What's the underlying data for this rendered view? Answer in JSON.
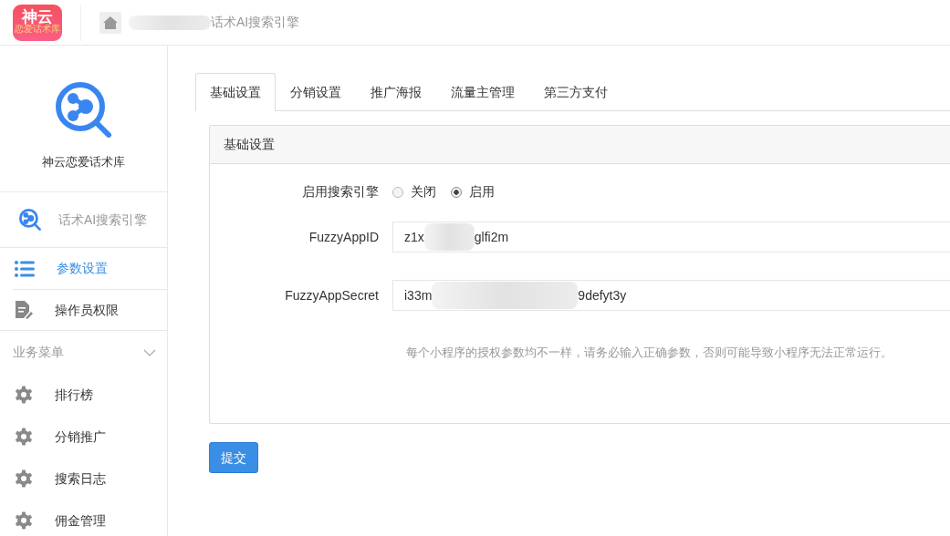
{
  "header": {
    "logo": {
      "title": "神云",
      "subtitle": "恋爱话术库"
    },
    "breadcrumb": "话术AI搜索引擎"
  },
  "sidebar": {
    "app_title": "神云恋爱话术库",
    "app_name": "话术AI搜索引擎",
    "menu": [
      {
        "label": "参数设置",
        "kind": "list",
        "selected": true
      },
      {
        "label": "操作员权限",
        "kind": "document",
        "selected": false
      }
    ],
    "group": {
      "label": "业务菜单",
      "expanded": true,
      "items": [
        {
          "label": "排行榜",
          "selected": false
        },
        {
          "label": "分销推广",
          "selected": false
        },
        {
          "label": "搜索日志",
          "selected": false
        },
        {
          "label": "佣金管理",
          "selected": false
        }
      ]
    }
  },
  "tabs": [
    {
      "label": "基础设置",
      "selected": true
    },
    {
      "label": "分销设置",
      "selected": false
    },
    {
      "label": "推广海报",
      "selected": false
    },
    {
      "label": "流量主管理",
      "selected": false
    },
    {
      "label": "第三方支付",
      "selected": false
    }
  ],
  "panel": {
    "title": "基础设置",
    "fields": [
      {
        "kind": "radio",
        "label": "启用搜索引擎",
        "options": [
          {
            "label": "关闭",
            "selected": false
          },
          {
            "label": "启用",
            "selected": true
          }
        ]
      },
      {
        "kind": "text",
        "label": "FuzzyAppID",
        "value_start": "z1x",
        "value_end": "glfi2m"
      },
      {
        "kind": "text",
        "label": "FuzzyAppSecret",
        "value_start": "i33m",
        "value_end": "9defyt3y"
      }
    ],
    "help": "每个小程序的授权参数均不一样，请务必输入正确参数，否则可能导致小程序无法正常运行。"
  },
  "submit": "提交"
}
